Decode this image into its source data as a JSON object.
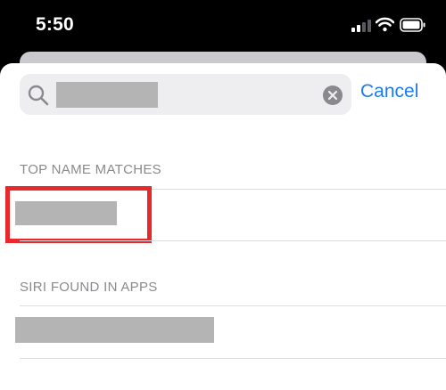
{
  "status_bar": {
    "time": "5:50",
    "icons": [
      "signal-icon",
      "wifi-icon",
      "battery-icon"
    ]
  },
  "search": {
    "icon": "search-icon",
    "clear_icon": "clear-icon",
    "cancel_label": "Cancel"
  },
  "sections": [
    {
      "header": "TOP NAME MATCHES"
    },
    {
      "header": "SIRI FOUND IN APPS"
    }
  ],
  "colors": {
    "accent": "#1a7cf5",
    "highlight": "#e8282b",
    "redaction": "#b4b4b4",
    "section_header": "#8a8a8e",
    "status_bar_background": "#000000"
  }
}
